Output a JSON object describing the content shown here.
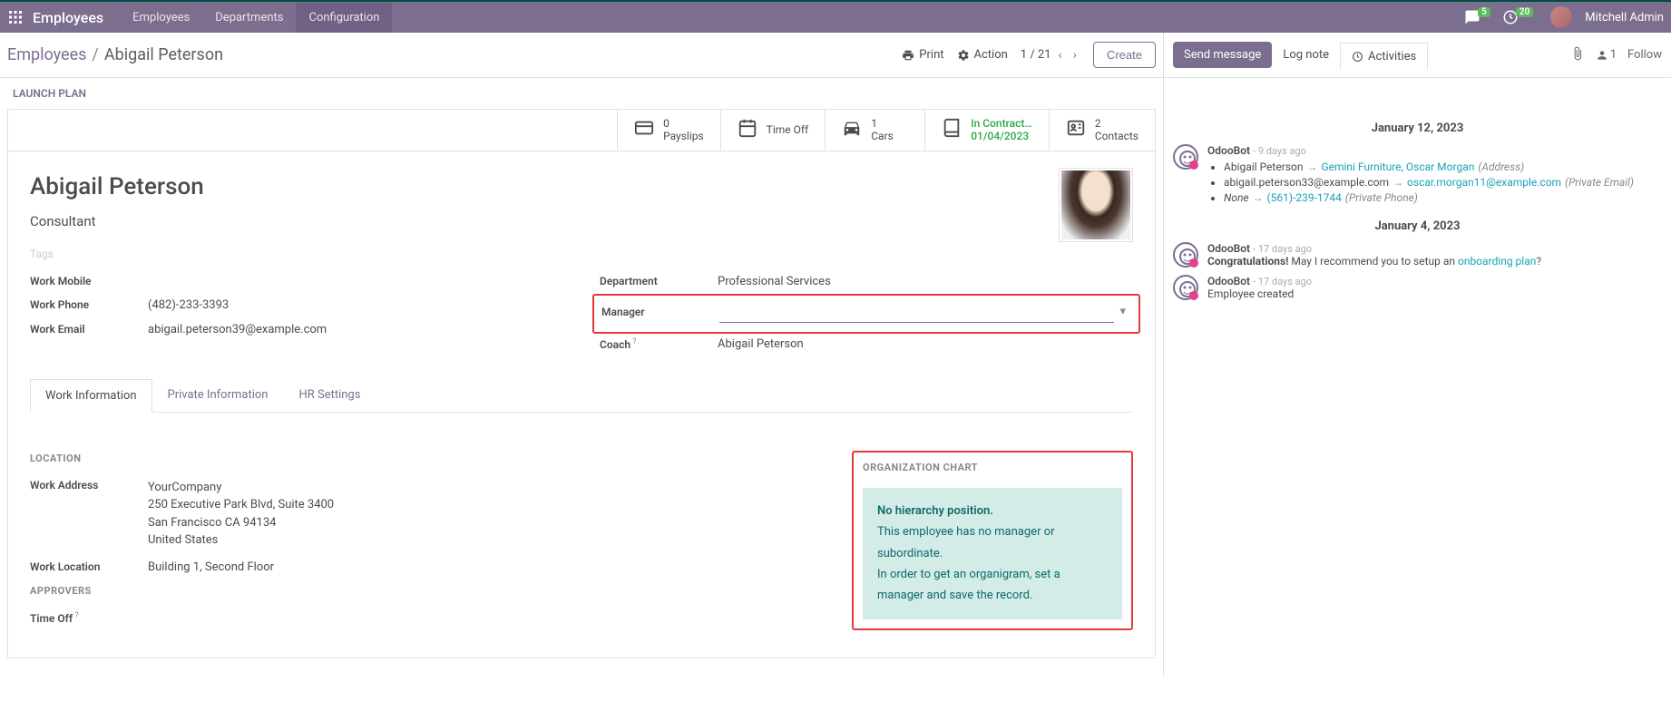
{
  "nav": {
    "brand": "Employees",
    "items": [
      "Employees",
      "Departments",
      "Configuration"
    ],
    "chat_count": "5",
    "clock_count": "20",
    "user": "Mitchell Admin"
  },
  "breadcrumb": {
    "root": "Employees",
    "current": "Abigail Peterson"
  },
  "toolbar": {
    "print": "Print",
    "action": "Action",
    "pager": "1 / 21",
    "create": "Create"
  },
  "chatter_head": {
    "send": "Send message",
    "lognote": "Log note",
    "activities": "Activities",
    "followers": "1",
    "follow": "Follow"
  },
  "launch_plan": "LAUNCH PLAN",
  "stats": {
    "payslips": {
      "val": "0",
      "lbl": "Payslips"
    },
    "timeoff": {
      "lbl": "Time Off"
    },
    "cars": {
      "val": "1",
      "lbl": "Cars"
    },
    "contract": {
      "status": "In Contract…",
      "date": "01/04/2023"
    },
    "contacts": {
      "val": "2",
      "lbl": "Contacts"
    }
  },
  "emp": {
    "name": "Abigail Peterson",
    "title": "Consultant",
    "tags": "Tags",
    "labels": {
      "work_mobile": "Work Mobile",
      "work_phone": "Work Phone",
      "work_email": "Work Email",
      "department": "Department",
      "manager": "Manager",
      "coach": "Coach"
    },
    "work_phone": "(482)-233-3393",
    "work_email": "abigail.peterson39@example.com",
    "department": "Professional Services",
    "coach": "Abigail Peterson"
  },
  "tabs": [
    "Work Information",
    "Private Information",
    "HR Settings"
  ],
  "work_info": {
    "section_location": "LOCATION",
    "work_address_lbl": "Work Address",
    "company": "YourCompany",
    "street": "250 Executive Park Blvd, Suite 3400",
    "city": "San Francisco CA 94134",
    "country": "United States",
    "work_location_lbl": "Work Location",
    "work_location": "Building 1, Second Floor",
    "section_approvers": "APPROVERS",
    "timeoff_lbl": "Time Off"
  },
  "org": {
    "heading": "ORGANIZATION CHART",
    "line1": "No hierarchy position.",
    "line2": "This employee has no manager or subordinate.",
    "line3": "In order to get an organigram, set a manager and save the record."
  },
  "chatter": {
    "date1": "January 12, 2023",
    "date2": "January 4, 2023",
    "bot": "OdooBot",
    "t9": "- 9 days ago",
    "t17": "- 17 days ago",
    "c1_name": "Abigail Peterson",
    "c1_new": "Gemini Furniture, Oscar Morgan",
    "c1_field": "(Address)",
    "c2_old": "abigail.peterson33@example.com",
    "c2_new": "oscar.morgan11@example.com",
    "c2_field": "(Private Email)",
    "c3_old": "None",
    "c3_new": "(561)-239-1744",
    "c3_field": "(Private Phone)",
    "congrats1": "Congratulations!",
    "congrats2": " May I recommend you to setup an ",
    "congrats3": "onboarding plan",
    "congrats4": "?",
    "created": "Employee created"
  }
}
